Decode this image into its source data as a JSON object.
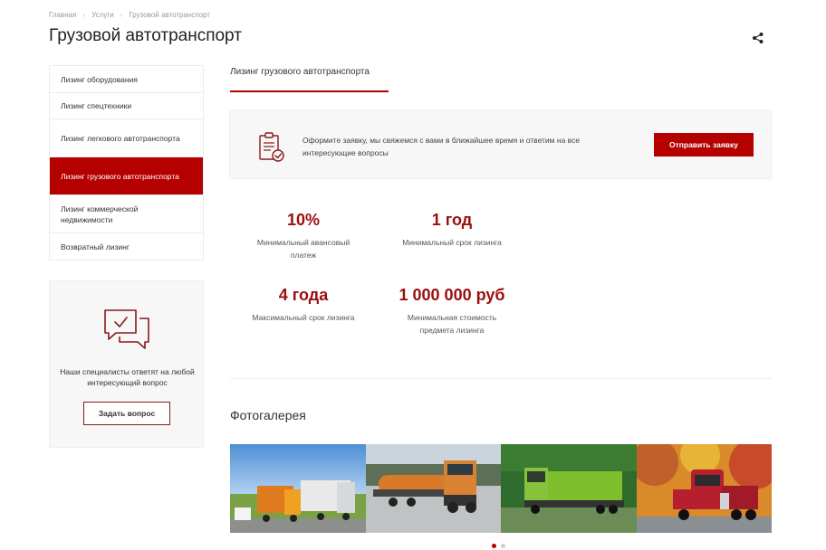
{
  "breadcrumb": {
    "items": [
      "Главная",
      "Услуги",
      "Грузовой автотранспорт"
    ]
  },
  "page": {
    "title": "Грузовой автотранспорт"
  },
  "sidebar": {
    "items": [
      {
        "label": "Лизинг оборудования",
        "active": false
      },
      {
        "label": "Лизинг спецтехники",
        "active": false
      },
      {
        "label": "Лизинг легкового автотранспорта",
        "active": false
      },
      {
        "label": "Лизинг грузового автотранспорта",
        "active": true
      },
      {
        "label": "Лизинг коммерческой недвижимости",
        "active": false
      },
      {
        "label": "Возвратный лизинг",
        "active": false
      }
    ],
    "help": {
      "text": "Наши специалисты ответят на любой интересующий вопрос",
      "button": "Задать вопрос"
    }
  },
  "main": {
    "tab": "Лизинг грузового автотранспорта",
    "cta": {
      "text": "Оформите заявку, мы свяжемся с вами в ближайшее время и ответим на все интересующие вопросы",
      "button": "Отправить заявку"
    },
    "stats": [
      {
        "value": "10%",
        "label": "Минимальный авансовый платеж"
      },
      {
        "value": "1 год",
        "label": "Минимальный срок лизинга"
      },
      {
        "value": "4 года",
        "label": "Максимальный срок лизинга"
      },
      {
        "value": "1 000 000 руб",
        "label": "Минимальная стоимость предмета лизинга"
      }
    ],
    "gallery": {
      "title": "Фотогалерея",
      "slides": 2,
      "active_slide": 1
    }
  },
  "colors": {
    "accent": "#b50000",
    "stat_value": "#9c0e0e",
    "panel_bg": "#f7f7f7"
  },
  "icons": [
    "share-icon",
    "document-check-icon",
    "chat-bubbles-icon"
  ]
}
